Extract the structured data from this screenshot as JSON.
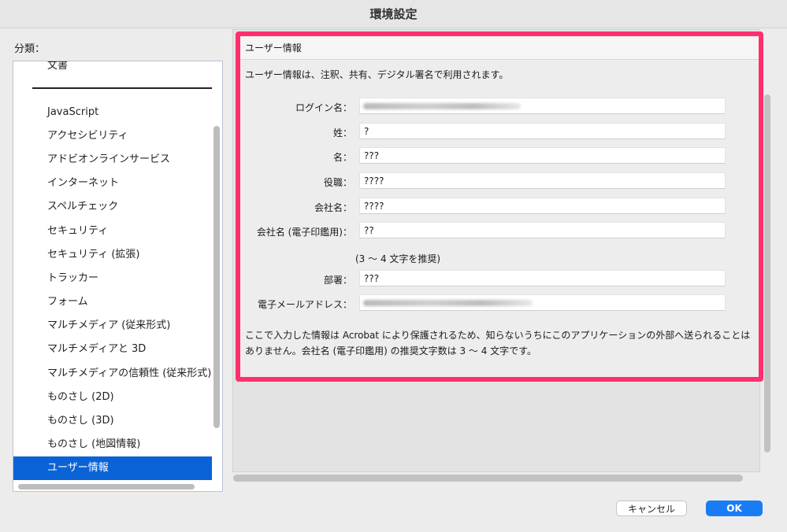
{
  "window": {
    "title": "環境設定"
  },
  "sidebar": {
    "label": "分類：",
    "items": [
      {
        "label": "文書",
        "selected": false
      },
      {
        "label": "JavaScript",
        "selected": false
      },
      {
        "label": "アクセシビリティ",
        "selected": false
      },
      {
        "label": "アドビオンラインサービス",
        "selected": false
      },
      {
        "label": "インターネット",
        "selected": false
      },
      {
        "label": "スペルチェック",
        "selected": false
      },
      {
        "label": "セキュリティ",
        "selected": false
      },
      {
        "label": "セキュリティ (拡張)",
        "selected": false
      },
      {
        "label": "トラッカー",
        "selected": false
      },
      {
        "label": "フォーム",
        "selected": false
      },
      {
        "label": "マルチメディア (従来形式)",
        "selected": false
      },
      {
        "label": "マルチメディアと 3D",
        "selected": false
      },
      {
        "label": "マルチメディアの信頼性 (従来形式)",
        "selected": false
      },
      {
        "label": "ものさし (2D)",
        "selected": false
      },
      {
        "label": "ものさし (3D)",
        "selected": false
      },
      {
        "label": "ものさし (地図情報)",
        "selected": false
      },
      {
        "label": "ユーザー情報",
        "selected": true
      }
    ]
  },
  "panel": {
    "header": "ユーザー情報",
    "intro": "ユーザー情報は、注釈、共有、デジタル署名で利用されます。",
    "fields": [
      {
        "label": "ログイン名：",
        "value": "",
        "blurred": true
      },
      {
        "label": "姓：",
        "value": "?",
        "blurred": false
      },
      {
        "label": "名：",
        "value": "???",
        "blurred": false
      },
      {
        "label": "役職：",
        "value": "????",
        "blurred": false
      },
      {
        "label": "会社名：",
        "value": "????",
        "blurred": false
      },
      {
        "label": "会社名 (電子印鑑用)：",
        "value": "??",
        "blurred": false
      },
      {
        "label": "部署：",
        "value": "???",
        "blurred": false
      },
      {
        "label": "電子メールアドレス：",
        "value": "",
        "blurred": true
      }
    ],
    "hint": "(3 〜 4 文字を推奨)",
    "notice": "ここで入力した情報は Acrobat により保護されるため、知らないうちにこのアプリケーションの外部へ送られることはありません。会社名 (電子印鑑用) の推奨文字数は 3 〜 4 文字です。"
  },
  "buttons": {
    "cancel": "キャンセル",
    "ok": "OK"
  },
  "colors": {
    "highlight_border": "#ff2f6d",
    "selection": "#0a63d6",
    "ok_button": "#1a7cf5"
  }
}
